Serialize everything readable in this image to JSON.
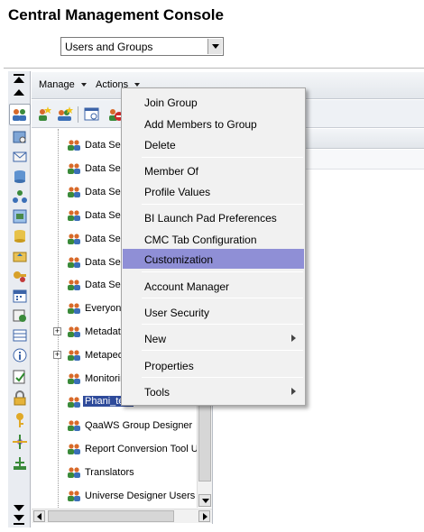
{
  "app": {
    "title": "Central Management Console"
  },
  "view_selector": {
    "value": "Users and Groups"
  },
  "menubar": {
    "manage": "Manage",
    "actions": "Actions"
  },
  "toolbar": {
    "icons": [
      "new-user-icon",
      "new-group-icon",
      "properties-icon",
      "delete-icon"
    ]
  },
  "tree": {
    "items": [
      {
        "label": "Data Ser",
        "icon": "group-icon"
      },
      {
        "label": "Data Ser",
        "icon": "group-icon"
      },
      {
        "label": "Data Ser",
        "icon": "group-icon"
      },
      {
        "label": "Data Ser",
        "icon": "group-icon"
      },
      {
        "label": "Data Ser",
        "icon": "group-icon"
      },
      {
        "label": "Data Ser",
        "icon": "group-icon"
      },
      {
        "label": "Data Ser",
        "icon": "group-icon"
      },
      {
        "label": "Everyon",
        "icon": "group-icon"
      },
      {
        "label": "Metadat",
        "icon": "group-icon",
        "expandable": true
      },
      {
        "label": "Metaped",
        "icon": "group-icon",
        "expandable": true
      },
      {
        "label": "Monitorin",
        "icon": "group-icon"
      },
      {
        "label": "Phani_test",
        "icon": "group-icon",
        "selected": true
      },
      {
        "label": "QaaWS Group Designer",
        "icon": "group-icon"
      },
      {
        "label": "Report Conversion Tool U",
        "icon": "group-icon"
      },
      {
        "label": "Translators",
        "icon": "group-icon"
      },
      {
        "label": "Universe Designer Users",
        "icon": "group-icon"
      }
    ]
  },
  "context_menu": {
    "join_group": "Join Group",
    "add_members": "Add Members to Group",
    "delete": "Delete",
    "member_of": "Member Of",
    "profile_values": "Profile Values",
    "bi_launch_pad": "BI Launch Pad Preferences",
    "cmc_tab_config": "CMC Tab Configuration",
    "customization": "Customization",
    "account_manager": "Account Manager",
    "user_security": "User Security",
    "new": "New",
    "properties": "Properties",
    "tools": "Tools"
  },
  "colors": {
    "highlight": "#8f8fd6",
    "selection": "#2f4b9b"
  }
}
